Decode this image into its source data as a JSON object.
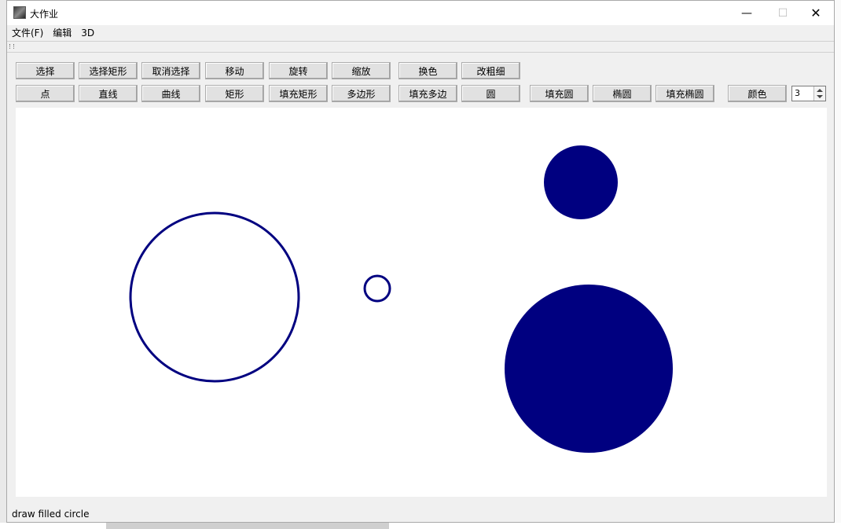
{
  "window": {
    "title": "大作业",
    "controls": {
      "minimize": "—",
      "maximize": "☐",
      "close": "✕"
    }
  },
  "menu": {
    "items": [
      "文件(F)",
      "编辑",
      "3D"
    ]
  },
  "toolbar": {
    "row1": [
      "选择",
      "选择矩形",
      "取消选择",
      "移动",
      "旋转",
      "缩放",
      "换色",
      "改粗细"
    ],
    "row2": [
      "点",
      "直线",
      "曲线",
      "矩形",
      "填充矩形",
      "多边形",
      "填充多边",
      "圆",
      "填充圆",
      "椭圆",
      "填充椭圆",
      "颜色"
    ],
    "width_value": "3"
  },
  "canvas": {
    "shape_color": "#000080",
    "shapes": [
      {
        "kind": "circle",
        "filled": false
      },
      {
        "kind": "circle",
        "filled": false
      },
      {
        "kind": "circle",
        "filled": true
      },
      {
        "kind": "circle",
        "filled": true
      }
    ]
  },
  "status": {
    "text": "draw filled circle"
  }
}
